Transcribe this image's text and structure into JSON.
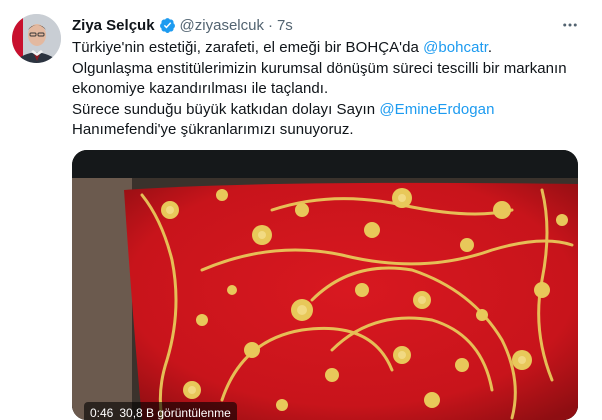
{
  "author": {
    "display_name": "Ziya Selçuk",
    "handle": "@ziyaselcuk",
    "separator": "·",
    "time": "7s",
    "verified_icon": "verified-badge-icon"
  },
  "tweet": {
    "line1_pre": "Türkiye'nin estetiği, zarafeti, el emeği bir BOHÇA'da ",
    "line1_mention": "@bohcatr",
    "line1_post": ".",
    "line2": "Olgunlaşma enstitülerimizin kurumsal dönüşüm süreci tescilli bir markanın",
    "line3": "ekonomiye kazandırılması ile taçlandı.",
    "line4_pre": "Sürece sunduğu büyük katkıdan dolayı Sayın ",
    "line4_mention": "@EmineErdogan",
    "line5": "Hanımefendi'ye şükranlarımızı sunuyoruz."
  },
  "video": {
    "timestamp": "0:46",
    "views": "30,8 B görüntülenme"
  },
  "colors": {
    "mention": "#1d9bf0",
    "verified": "#1d9bf0",
    "fabric_red": "#c8141b",
    "embroidery_gold": "#e8c85a"
  }
}
